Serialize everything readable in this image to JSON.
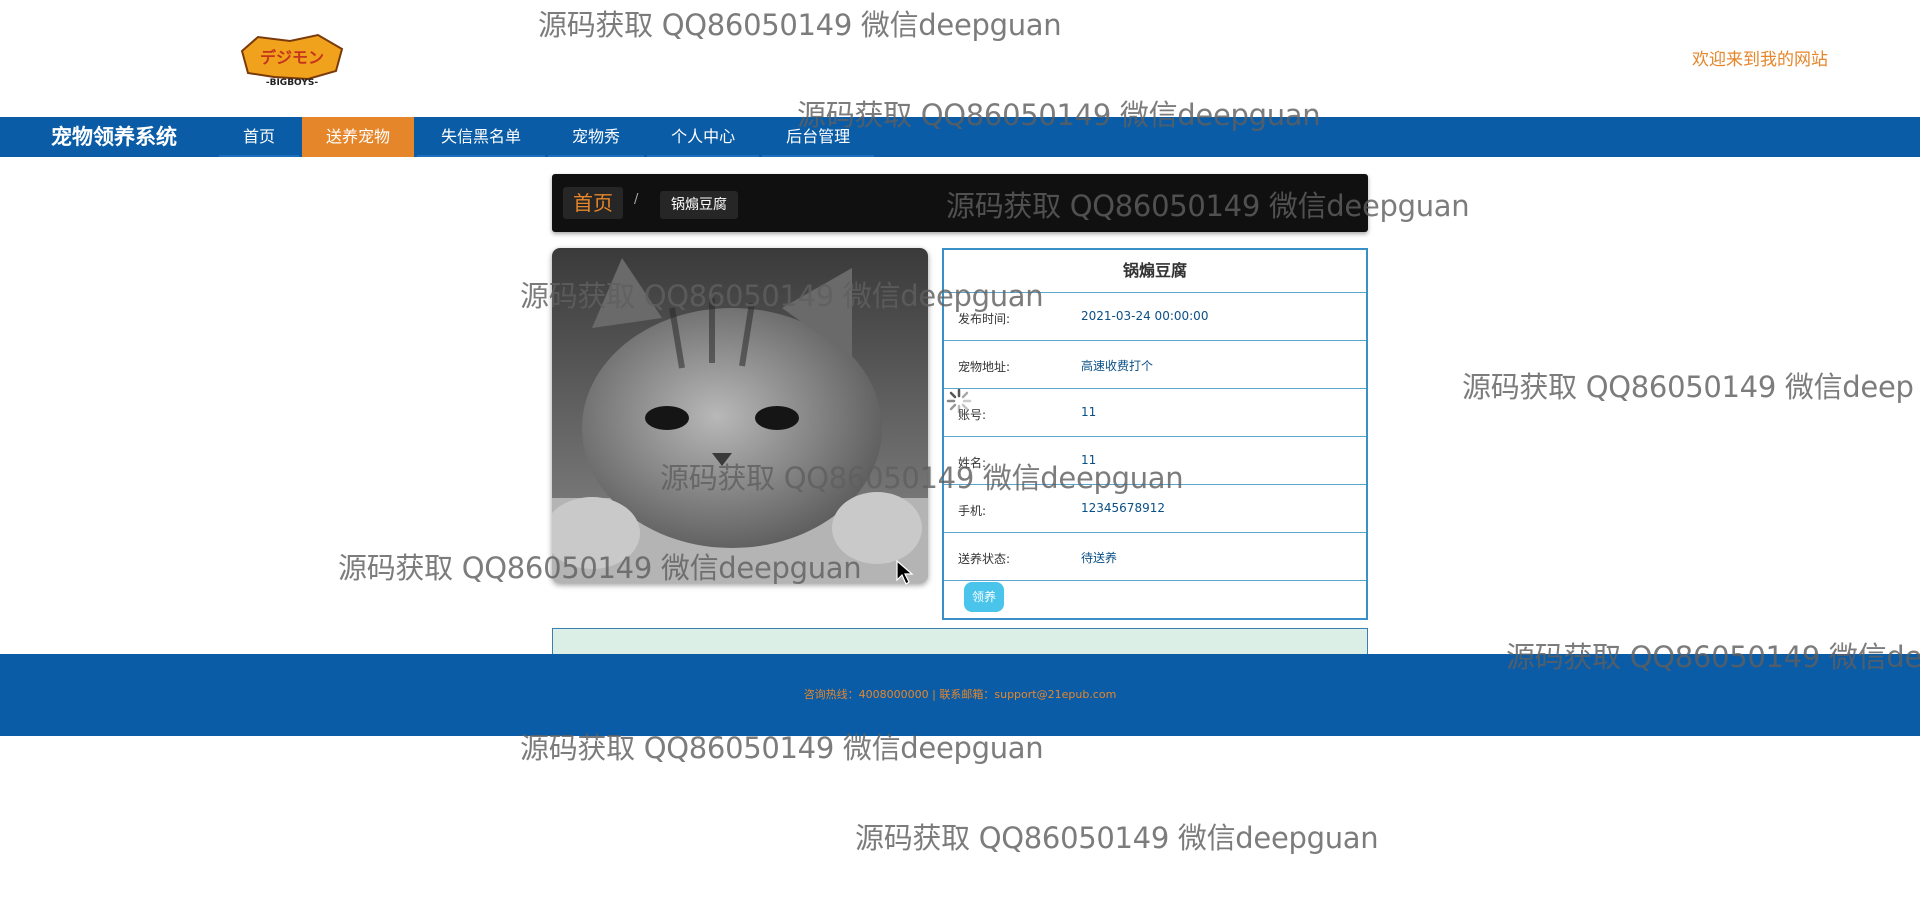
{
  "header": {
    "logo_text": "BIGBOYS",
    "welcome": "欢迎来到我的网站"
  },
  "navbar": {
    "site_title": "宠物领养系统",
    "items": [
      {
        "label": "首页",
        "active": false
      },
      {
        "label": "送养宠物",
        "active": true
      },
      {
        "label": "失信黑名单",
        "active": false
      },
      {
        "label": "宠物秀",
        "active": false
      },
      {
        "label": "个人中心",
        "active": false
      },
      {
        "label": "后台管理",
        "active": false
      }
    ]
  },
  "breadcrumb": {
    "home": "首页",
    "separator": "/",
    "current": "锅煽豆腐"
  },
  "pet": {
    "image_alt": "grayscale tabby cat",
    "title": "锅煽豆腐",
    "fields": [
      {
        "label": "发布时间:",
        "value": "2021-03-24 00:00:00"
      },
      {
        "label": "宠物地址:",
        "value": "高速收费打个"
      },
      {
        "label": "账号:",
        "value": "11"
      },
      {
        "label": "姓名:",
        "value": "11"
      },
      {
        "label": "手机:",
        "value": "12345678912"
      },
      {
        "label": "送养状态:",
        "value": "待送养"
      }
    ],
    "adopt_button": "领养"
  },
  "footer": {
    "text": "咨询热线：4008000000 | 联系邮箱：support@21epub.com"
  },
  "watermark": {
    "text": "源码获取 QQ86050149 微信deepguan",
    "text_cut_1": "源码获取 QQ86050149 微信deep",
    "text_cut_2": "源码获取 QQ86050149 微信de"
  },
  "colors": {
    "nav_blue": "#0a5ca6",
    "accent_orange": "#e6862a",
    "panel_border": "#3a8fc6",
    "button_cyan": "#4bc4ec"
  }
}
